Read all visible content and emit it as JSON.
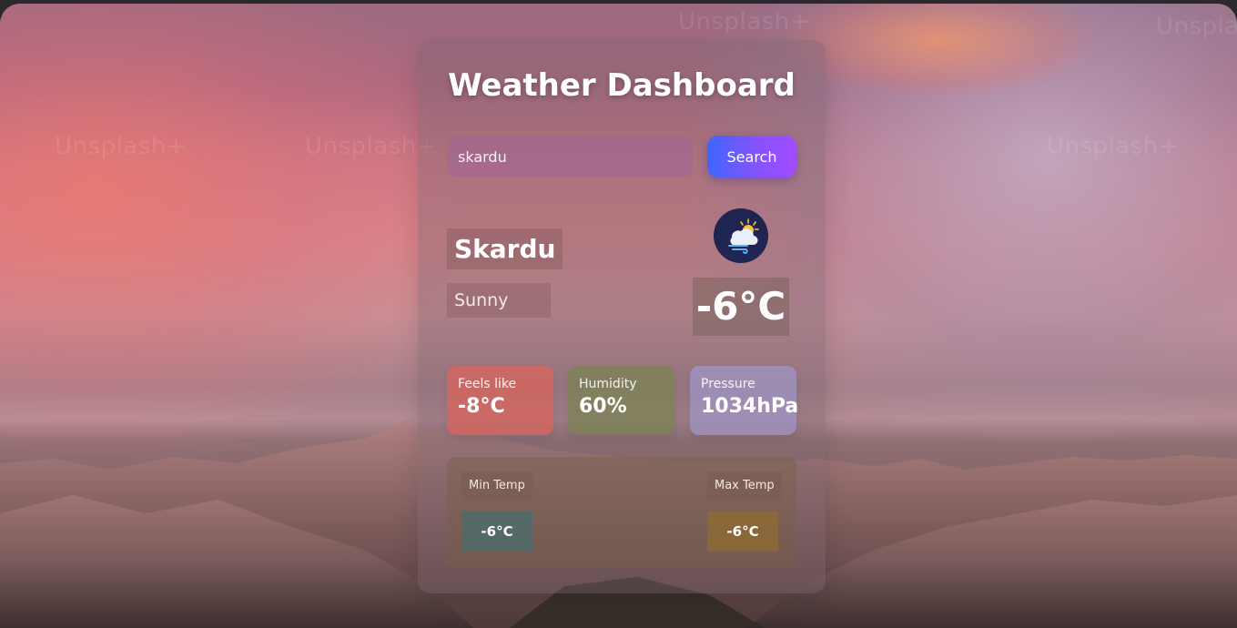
{
  "app": {
    "title": "Weather Dashboard"
  },
  "search": {
    "value": "skardu",
    "button_label": "Search"
  },
  "current": {
    "city": "Skardu",
    "condition": "Sunny",
    "temperature": "-6°C",
    "icon": "sun-cloud-wind-icon"
  },
  "stats": {
    "feels_like": {
      "label": "Feels like",
      "value": "-8°C"
    },
    "humidity": {
      "label": "Humidity",
      "value": "60%"
    },
    "pressure": {
      "label": "Pressure",
      "value": "1034hPa"
    }
  },
  "range": {
    "min": {
      "label": "Min Temp",
      "value": "-6°C"
    },
    "max": {
      "label": "Max Temp",
      "value": "-6°C"
    }
  },
  "background": {
    "watermark": "Unsplash+"
  },
  "colors": {
    "search_button_start": "#3f66ff",
    "search_button_end": "#a04cff",
    "icon_bg": "#1f2450"
  }
}
